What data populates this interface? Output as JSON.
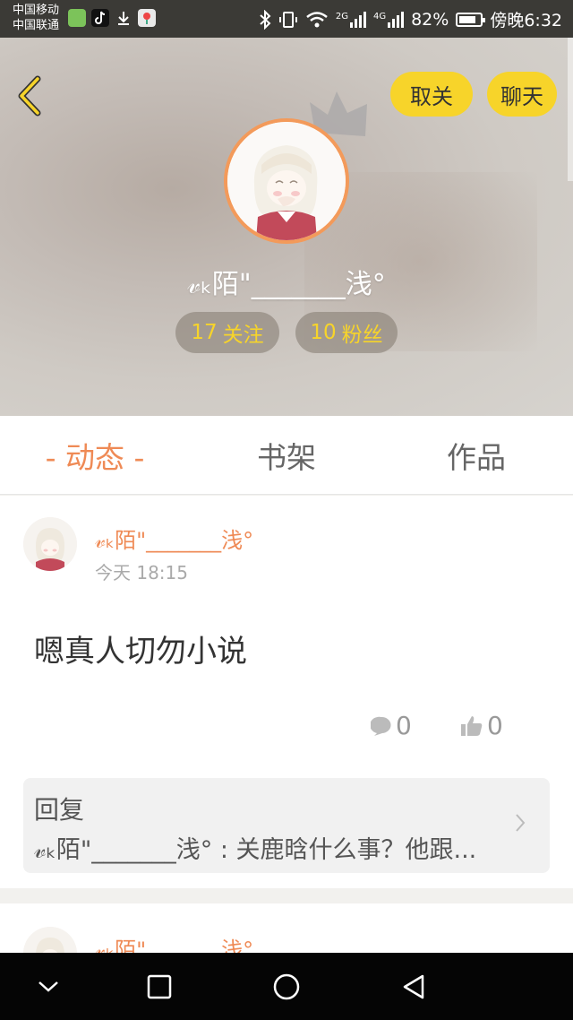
{
  "status_bar": {
    "carrier_1": "中国移动",
    "carrier_2": "中国联通",
    "network_2g": "2G",
    "network_4g": "4G",
    "battery": "82%",
    "time": "傍晚6:32",
    "battery_level": 0.82
  },
  "profile": {
    "unfollow_label": "取关",
    "chat_label": "聊天",
    "username": "𝓋ₖ陌\"_______浅°",
    "follow_count": "17",
    "follow_label": "关注",
    "fans_count": "10",
    "fans_label": "粉丝"
  },
  "tabs": [
    {
      "label": "- 动态 -",
      "active": true
    },
    {
      "label": "书架",
      "active": false
    },
    {
      "label": "作品",
      "active": false
    }
  ],
  "post": {
    "author": "𝓋ₖ陌\"_______浅°",
    "time": "今天 18:15",
    "body": "嗯真人切勿小说",
    "comment_count": "0",
    "like_count": "0",
    "reply_title": "回复",
    "reply_text": "𝓋ₖ陌\"_______浅° : 关鹿晗什么事？他跟..."
  },
  "post2": {
    "author": "𝓋ₖ陌\"_______浅°"
  },
  "colors": {
    "accent": "#ef8a55",
    "button_yellow": "#f7d42a",
    "avatar_ring": "#f39a5a"
  },
  "icons": [
    "back-icon",
    "crown-icon",
    "comment-icon",
    "thumbs-up-icon",
    "chevron-right-icon",
    "nav-back-icon",
    "nav-home-icon",
    "nav-recents-icon",
    "nav-collapse-icon"
  ]
}
